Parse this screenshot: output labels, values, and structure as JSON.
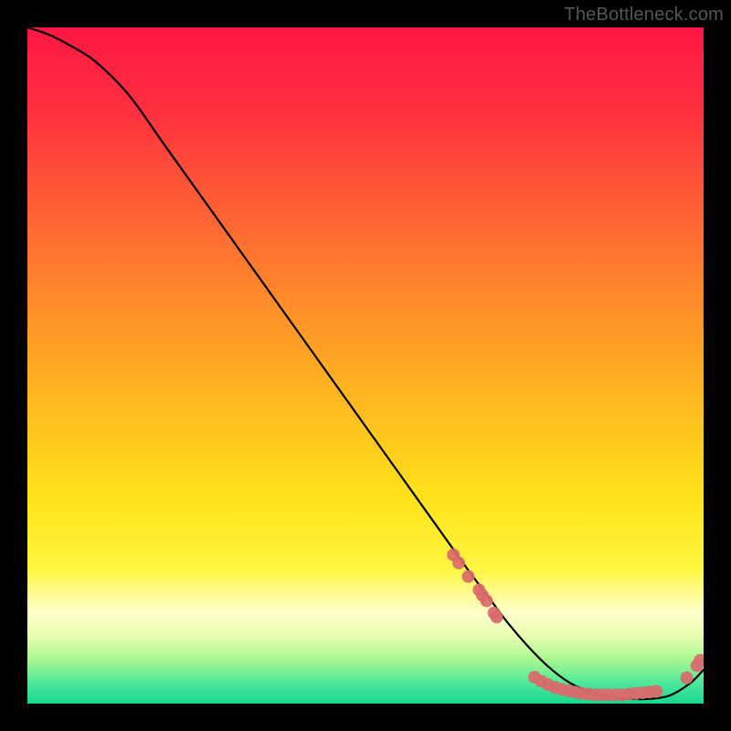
{
  "watermark": "TheBottleneck.com",
  "chart_data": {
    "type": "line",
    "title": "",
    "xlabel": "",
    "ylabel": "",
    "xlim": [
      0,
      100
    ],
    "ylim": [
      0,
      100
    ],
    "grid": false,
    "gradient_stops": [
      {
        "offset": 0.0,
        "color": "#ff1744"
      },
      {
        "offset": 0.12,
        "color": "#ff2f3f"
      },
      {
        "offset": 0.25,
        "color": "#ff5a36"
      },
      {
        "offset": 0.4,
        "color": "#ff8a2a"
      },
      {
        "offset": 0.55,
        "color": "#ffb81f"
      },
      {
        "offset": 0.7,
        "color": "#ffe31a"
      },
      {
        "offset": 0.8,
        "color": "#fff640"
      },
      {
        "offset": 0.865,
        "color": "#ffffcc"
      },
      {
        "offset": 0.9,
        "color": "#e8ffb0"
      },
      {
        "offset": 0.935,
        "color": "#a8f78f"
      },
      {
        "offset": 0.97,
        "color": "#4de89a"
      },
      {
        "offset": 1.0,
        "color": "#18d890"
      }
    ],
    "curve": {
      "name": "bottleneck-curve",
      "x": [
        0,
        3,
        6,
        10,
        15,
        20,
        25,
        30,
        35,
        40,
        45,
        50,
        55,
        60,
        65,
        68,
        71,
        74,
        77,
        80,
        83,
        86,
        89,
        92,
        95,
        98,
        100
      ],
      "y": [
        100,
        99,
        97.5,
        95,
        90,
        83,
        76,
        69,
        62,
        55,
        48,
        41,
        34,
        27,
        20,
        16,
        12,
        8.5,
        5.5,
        3.2,
        1.8,
        1.0,
        0.7,
        0.7,
        1.2,
        3.0,
        5.0
      ]
    },
    "scatter_clusters": [
      {
        "name": "upper-cluster",
        "color": "#d96a6a",
        "points": [
          {
            "x": 63.0,
            "y": 22.0
          },
          {
            "x": 63.8,
            "y": 20.8
          },
          {
            "x": 65.2,
            "y": 18.8
          },
          {
            "x": 66.8,
            "y": 16.8
          },
          {
            "x": 67.3,
            "y": 16.0
          },
          {
            "x": 67.9,
            "y": 15.2
          },
          {
            "x": 69.0,
            "y": 13.4
          },
          {
            "x": 69.4,
            "y": 12.8
          }
        ]
      },
      {
        "name": "bottom-cluster",
        "color": "#d96a6a",
        "points": [
          {
            "x": 75.0,
            "y": 3.9
          },
          {
            "x": 76.0,
            "y": 3.3
          },
          {
            "x": 77.0,
            "y": 2.8
          },
          {
            "x": 78.0,
            "y": 2.4
          },
          {
            "x": 79.0,
            "y": 2.1
          },
          {
            "x": 80.0,
            "y": 1.9
          },
          {
            "x": 81.0,
            "y": 1.7
          },
          {
            "x": 82.0,
            "y": 1.5
          },
          {
            "x": 83.0,
            "y": 1.4
          },
          {
            "x": 84.0,
            "y": 1.3
          },
          {
            "x": 85.0,
            "y": 1.3
          },
          {
            "x": 86.0,
            "y": 1.3
          },
          {
            "x": 87.0,
            "y": 1.3
          },
          {
            "x": 88.0,
            "y": 1.3
          },
          {
            "x": 89.0,
            "y": 1.4
          },
          {
            "x": 90.0,
            "y": 1.5
          },
          {
            "x": 91.0,
            "y": 1.6
          },
          {
            "x": 92.0,
            "y": 1.7
          },
          {
            "x": 93.0,
            "y": 1.8
          }
        ]
      },
      {
        "name": "right-cluster",
        "color": "#d96a6a",
        "points": [
          {
            "x": 97.5,
            "y": 3.8
          },
          {
            "x": 99.0,
            "y": 5.6
          },
          {
            "x": 99.5,
            "y": 6.4
          }
        ]
      }
    ]
  }
}
